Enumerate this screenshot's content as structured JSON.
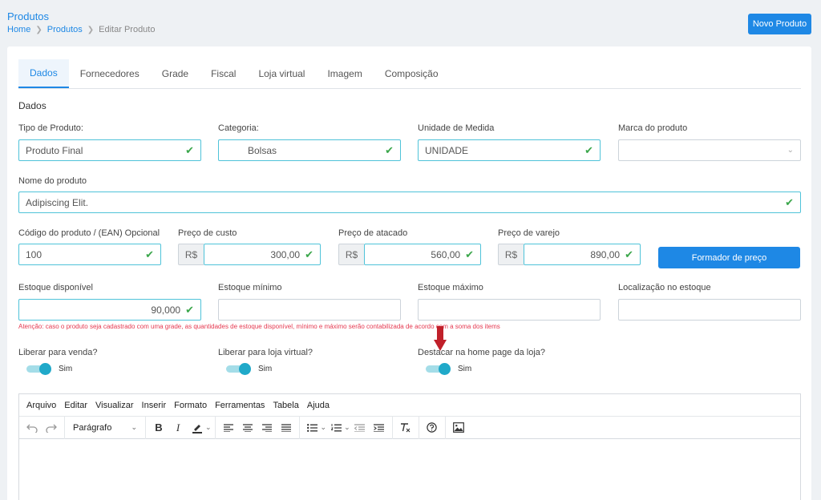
{
  "header": {
    "title": "Produtos",
    "breadcrumb": [
      "Home",
      "Produtos",
      "Editar Produto"
    ],
    "new_button": "Novo Produto"
  },
  "tabs": [
    "Dados",
    "Fornecedores",
    "Grade",
    "Fiscal",
    "Loja virtual",
    "Imagem",
    "Composição"
  ],
  "section_title": "Dados",
  "fields": {
    "tipo_produto": {
      "label": "Tipo de Produto:",
      "value": "Produto Final"
    },
    "categoria": {
      "label": "Categoria:",
      "value": "Bolsas"
    },
    "unidade": {
      "label": "Unidade de Medida",
      "value": "UNIDADE"
    },
    "marca": {
      "label": "Marca do produto",
      "value": ""
    },
    "nome": {
      "label": "Nome do produto",
      "value": "Adipiscing Elit."
    },
    "codigo": {
      "label": "Código do produto / (EAN) Opcional",
      "value": "100"
    },
    "preco_custo": {
      "label": "Preço de custo",
      "prefix": "R$",
      "value": "300,00"
    },
    "preco_atacado": {
      "label": "Preço de atacado",
      "prefix": "R$",
      "value": "560,00"
    },
    "preco_varejo": {
      "label": "Preço de varejo",
      "prefix": "R$",
      "value": "890,00"
    },
    "estoque_disp": {
      "label": "Estoque disponível",
      "value": "90,000"
    },
    "estoque_min": {
      "label": "Estoque mínimo",
      "value": ""
    },
    "estoque_max": {
      "label": "Estoque máximo",
      "value": ""
    },
    "localizacao": {
      "label": "Localização no estoque",
      "value": ""
    }
  },
  "formador_button": "Formador de preço",
  "warning": "Atenção: caso o produto seja cadastrado com uma grade, as quantidades de estoque disponível, mínimo e máximo serão contabilizada de acordo com a soma dos items",
  "toggles": [
    {
      "label": "Liberar para venda?",
      "state": "Sim",
      "on": true
    },
    {
      "label": "Liberar para loja virtual?",
      "state": "Sim",
      "on": true
    },
    {
      "label": "Destacar na home page da loja?",
      "state": "Sim",
      "on": true
    }
  ],
  "editor": {
    "menu": [
      "Arquivo",
      "Editar",
      "Visualizar",
      "Inserir",
      "Formato",
      "Ferramentas",
      "Tabela",
      "Ajuda"
    ],
    "block_format": "Parágrafo",
    "bold": "B",
    "italic": "I"
  },
  "colors": {
    "accent": "#1e88e5",
    "valid_border": "#4fc3d9",
    "check": "#3aa64a",
    "toggle": "#20a9c9",
    "warning": "#e53950",
    "arrow": "#c0202a"
  }
}
